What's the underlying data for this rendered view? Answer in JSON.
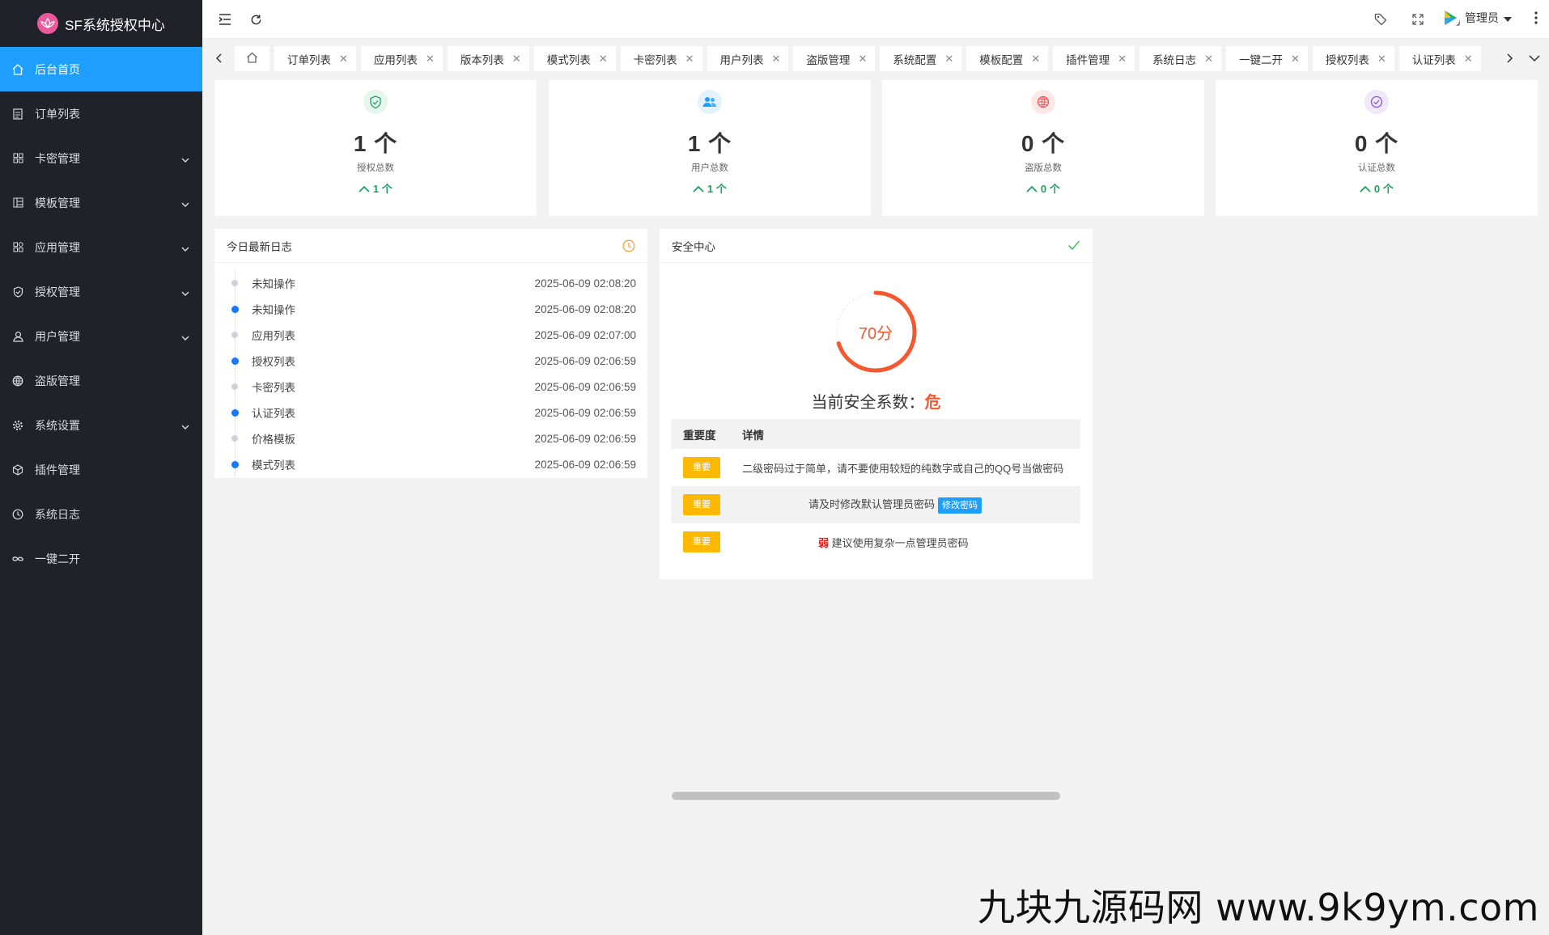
{
  "brand": {
    "title": "SF系统授权中心"
  },
  "sidebar": {
    "items": [
      {
        "label": "后台首页",
        "icon": "home-icon",
        "active": true,
        "expandable": false
      },
      {
        "label": "订单列表",
        "icon": "document-icon",
        "active": false,
        "expandable": false
      },
      {
        "label": "卡密管理",
        "icon": "grid-icon",
        "active": false,
        "expandable": true
      },
      {
        "label": "模板管理",
        "icon": "template-icon",
        "active": false,
        "expandable": true
      },
      {
        "label": "应用管理",
        "icon": "apps-icon",
        "active": false,
        "expandable": true
      },
      {
        "label": "授权管理",
        "icon": "shield-icon",
        "active": false,
        "expandable": true
      },
      {
        "label": "用户管理",
        "icon": "user-icon",
        "active": false,
        "expandable": true
      },
      {
        "label": "盗版管理",
        "icon": "globe-icon",
        "active": false,
        "expandable": false
      },
      {
        "label": "系统设置",
        "icon": "gear-icon",
        "active": false,
        "expandable": true
      },
      {
        "label": "插件管理",
        "icon": "cube-icon",
        "active": false,
        "expandable": false
      },
      {
        "label": "系统日志",
        "icon": "clock-icon",
        "active": false,
        "expandable": false
      },
      {
        "label": "一键二开",
        "icon": "infinity-icon",
        "active": false,
        "expandable": false
      }
    ]
  },
  "header": {
    "admin_label": "管理员"
  },
  "tabs": [
    "订单列表",
    "应用列表",
    "版本列表",
    "模式列表",
    "卡密列表",
    "用户列表",
    "盗版管理",
    "系统配置",
    "模板配置",
    "插件管理",
    "系统日志",
    "一键二开",
    "授权列表",
    "认证列表"
  ],
  "stats": [
    {
      "num": "1 个",
      "label": "授权总数",
      "delta": "1 个",
      "icon": "shield-check-icon",
      "color": "#1aa260",
      "bg": "#e6f6ec"
    },
    {
      "num": "1 个",
      "label": "用户总数",
      "delta": "1 个",
      "icon": "users-icon",
      "color": "#1e9fff",
      "bg": "#e4f2ff"
    },
    {
      "num": "0 个",
      "label": "盗版总数",
      "delta": "0 个",
      "icon": "globe-icon",
      "color": "#f05050",
      "bg": "#fde8e8"
    },
    {
      "num": "0 个",
      "label": "认证总数",
      "delta": "0 个",
      "icon": "check-circle-icon",
      "color": "#8a56d8",
      "bg": "#f0e8fb"
    }
  ],
  "logs": {
    "title": "今日最新日志",
    "items": [
      {
        "name": "未知操作",
        "time": "2025-06-09 02:08:20",
        "dot": "grey"
      },
      {
        "name": "未知操作",
        "time": "2025-06-09 02:08:20",
        "dot": "blue"
      },
      {
        "name": "应用列表",
        "time": "2025-06-09 02:07:00",
        "dot": "grey"
      },
      {
        "name": "授权列表",
        "time": "2025-06-09 02:06:59",
        "dot": "blue"
      },
      {
        "name": "卡密列表",
        "time": "2025-06-09 02:06:59",
        "dot": "grey"
      },
      {
        "name": "认证列表",
        "time": "2025-06-09 02:06:59",
        "dot": "blue"
      },
      {
        "name": "价格模板",
        "time": "2025-06-09 02:06:59",
        "dot": "grey"
      },
      {
        "name": "模式列表",
        "time": "2025-06-09 02:06:59",
        "dot": "blue"
      }
    ]
  },
  "security": {
    "title": "安全中心",
    "score_text": "70分",
    "score": 70,
    "status_prefix": "当前安全系数：",
    "status_level": "危",
    "table_head": {
      "col1": "重要度",
      "col2": "详情"
    },
    "rows": [
      {
        "badge": "重要",
        "detail": "二级密码过于简单，请不要使用较短的纯数字或自己的QQ号当做密码"
      },
      {
        "badge": "重要",
        "detail": "请及时修改默认管理员密码",
        "action": "修改密码"
      },
      {
        "badge": "重要",
        "weak": "弱",
        "detail": "建议使用复杂一点管理员密码"
      }
    ]
  },
  "watermark": "九块九源码网 www.9k9ym.com"
}
